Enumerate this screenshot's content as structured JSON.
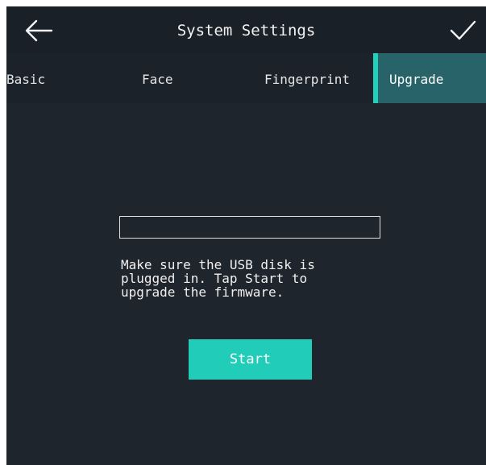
{
  "header": {
    "title": "System Settings",
    "back_icon": "back-arrow-icon",
    "confirm_icon": "checkmark-icon"
  },
  "tabs": [
    {
      "label": "Basic",
      "active": false
    },
    {
      "label": "Face",
      "active": false
    },
    {
      "label": "Fingerprint",
      "active": false
    },
    {
      "label": "Upgrade",
      "active": true
    }
  ],
  "upgrade": {
    "progress": 0,
    "hint": "Make sure the USB disk is\nplugged in. Tap Start to\nupgrade the firmware.",
    "start_label": "Start"
  },
  "colors": {
    "background": "#1f252c",
    "accent": "#20d0b9",
    "active_tab_bg": "#286369"
  }
}
